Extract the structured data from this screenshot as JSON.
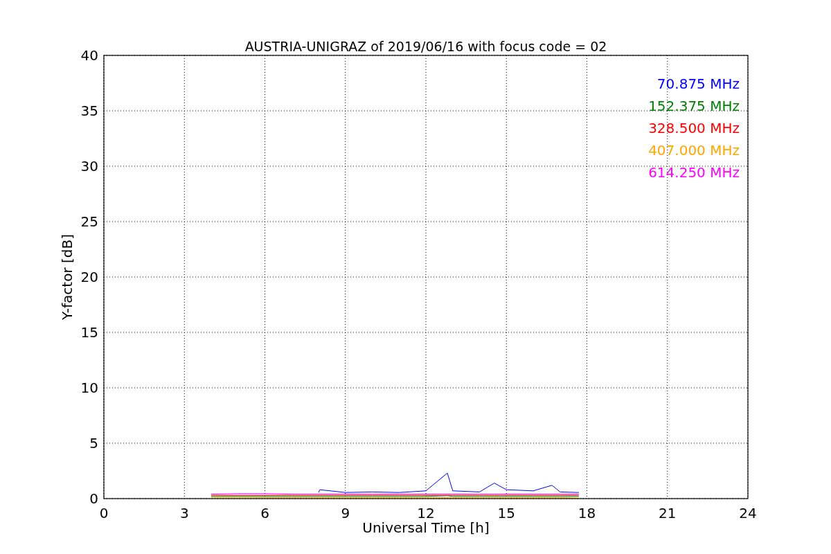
{
  "figure": {
    "chart_data": {
      "type": "line",
      "title": "AUSTRIA-UNIGRAZ of 2019/06/16 with focus code = 02",
      "xlabel": "Universal Time [h]",
      "ylabel": "Y-factor [dB]",
      "grid": true,
      "x": [
        4,
        5,
        6,
        7,
        8,
        8.05,
        9,
        10,
        11,
        12,
        12.8,
        13,
        14,
        14.55,
        15,
        16,
        16.7,
        17,
        17.7
      ],
      "series": [
        {
          "name": "70.875 MHz",
          "color": "#0000ff",
          "values": [
            null,
            null,
            null,
            null,
            0.55,
            0.8,
            0.55,
            0.6,
            0.55,
            0.7,
            2.3,
            0.7,
            0.6,
            1.4,
            0.8,
            0.7,
            1.2,
            0.6,
            0.55
          ]
        },
        {
          "name": "152.375 MHz",
          "color": "#008000",
          "values": [
            0.2,
            0.2,
            0.2,
            0.2,
            0.2,
            0.2,
            0.2,
            0.2,
            0.2,
            0.2,
            0.26,
            0.2,
            0.2,
            0.2,
            0.2,
            0.2,
            0.2,
            0.2,
            0.2
          ]
        },
        {
          "name": "328.500 MHz",
          "color": "#ff0000",
          "values": [
            0.3,
            0.3,
            0.3,
            0.3,
            0.3,
            0.3,
            0.3,
            0.3,
            0.3,
            0.3,
            0.3,
            0.3,
            0.3,
            0.3,
            0.3,
            0.3,
            0.3,
            0.3,
            0.3
          ]
        },
        {
          "name": "407.000 MHz",
          "color": "#ffa500",
          "values": [
            0.12,
            0.12,
            0.1,
            0.1,
            0.1,
            0.1,
            0.1,
            0.1,
            0.1,
            0.1,
            0.1,
            0.1,
            0.1,
            0.1,
            0.1,
            0.1,
            0.1,
            0.1,
            0.05
          ]
        },
        {
          "name": "614.250 MHz",
          "color": "#ff00ff",
          "values": [
            0.4,
            0.45,
            0.45,
            0.4,
            0.4,
            0.4,
            0.4,
            0.4,
            0.4,
            0.4,
            0.4,
            0.4,
            0.4,
            0.4,
            0.4,
            0.4,
            0.4,
            0.4,
            0.4
          ]
        }
      ],
      "xlim": [
        0,
        24
      ],
      "ylim": [
        0,
        40
      ],
      "xticks": [
        0,
        3,
        6,
        9,
        12,
        15,
        18,
        21,
        24
      ],
      "yticks": [
        0,
        5,
        10,
        15,
        20,
        25,
        30,
        35,
        40
      ]
    }
  }
}
